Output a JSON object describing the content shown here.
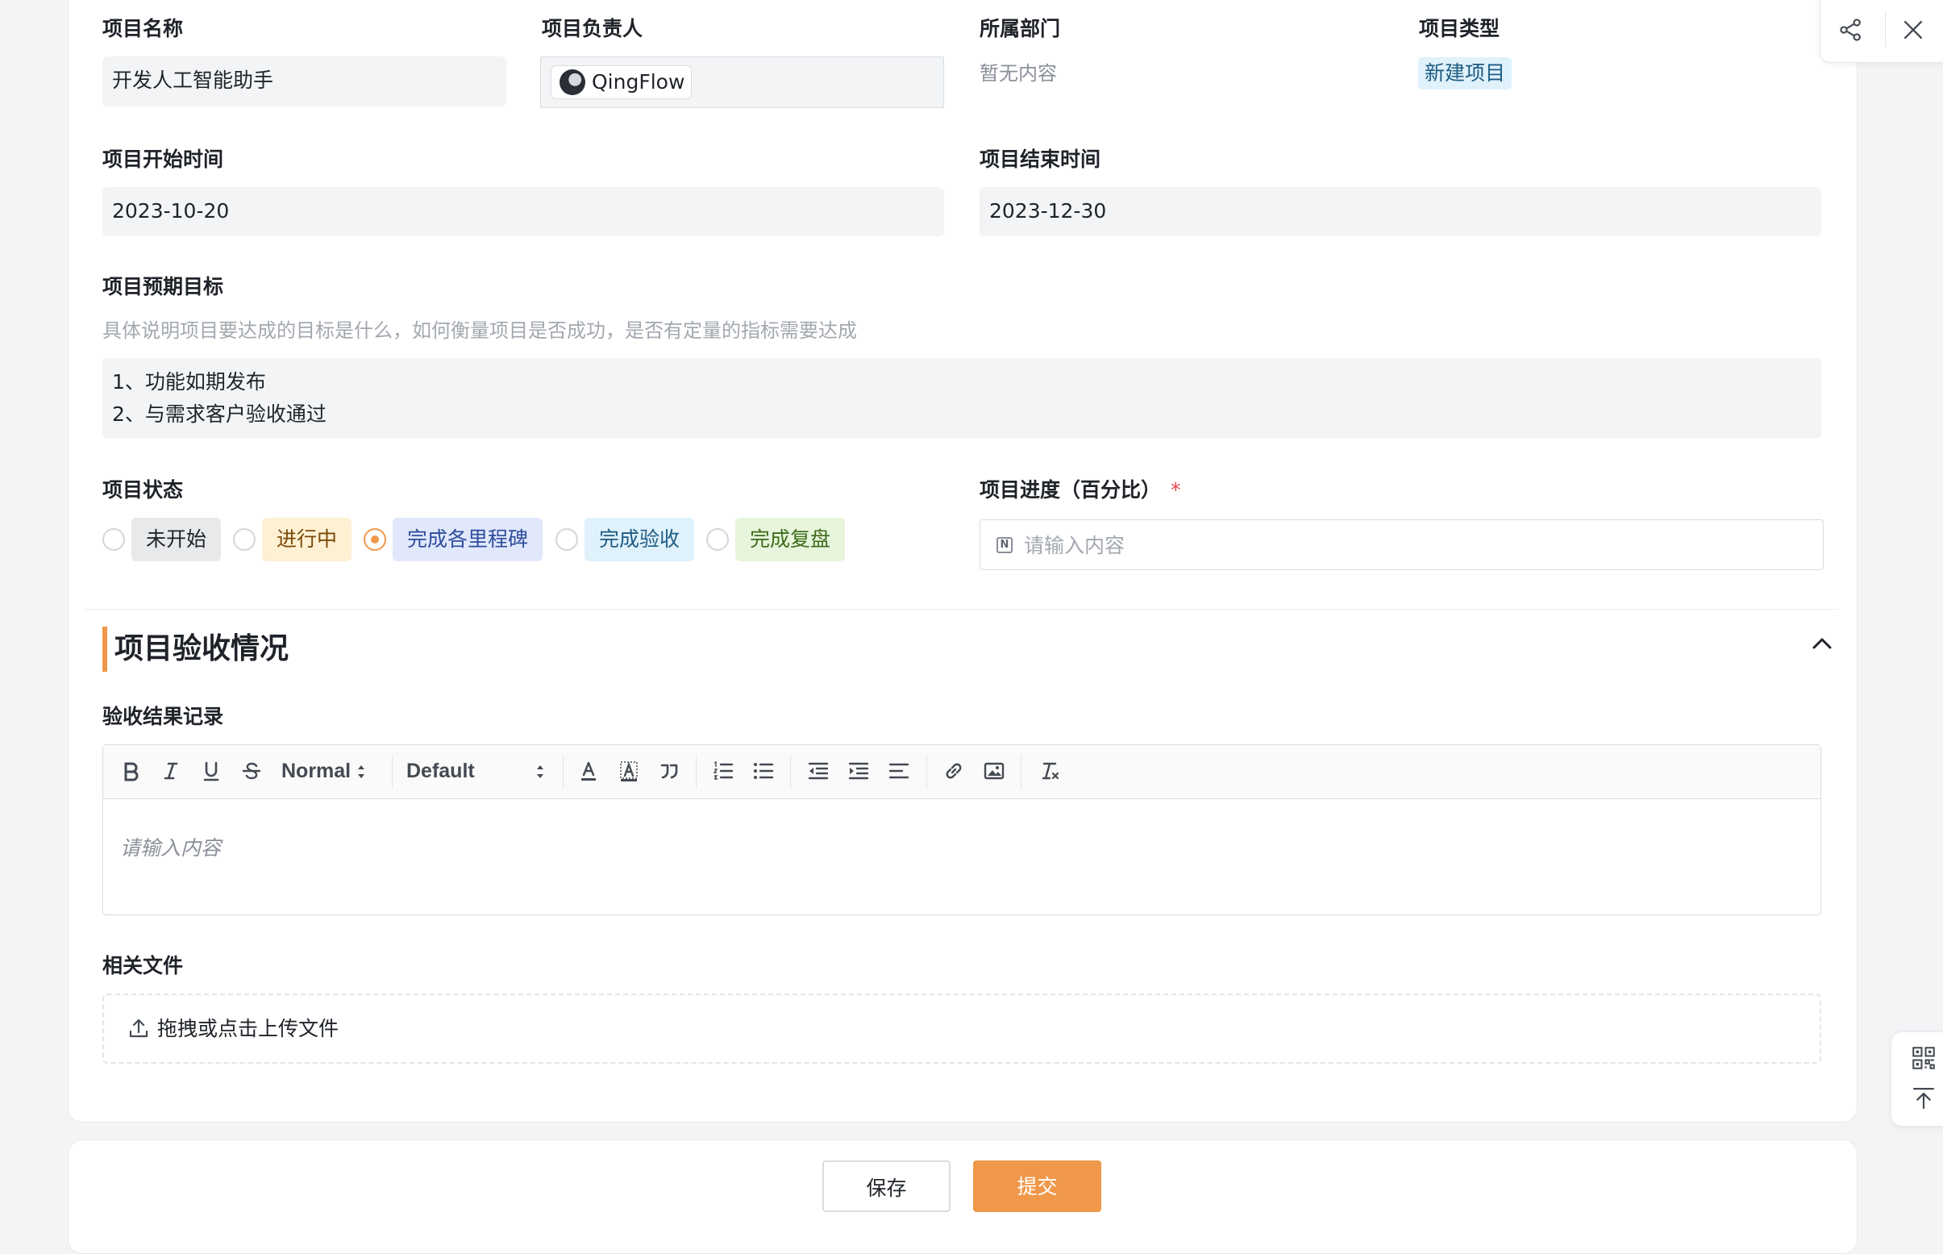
{
  "form": {
    "project_name": {
      "label": "项目名称",
      "value": "开发人工智能助手"
    },
    "owner": {
      "label": "项目负责人",
      "value": "QingFlow"
    },
    "department": {
      "label": "所属部门",
      "value": "暂无内容"
    },
    "project_type": {
      "label": "项目类型",
      "value": "新建项目"
    },
    "start_time": {
      "label": "项目开始时间",
      "value": "2023-10-20"
    },
    "end_time": {
      "label": "项目结束时间",
      "value": "2023-12-30"
    },
    "goal": {
      "label": "项目预期目标",
      "hint": "具体说明项目要达成的目标是什么，如何衡量项目是否成功，是否有定量的指标需要达成",
      "lines": [
        "1、功能如期发布",
        "2、与需求客户验收通过"
      ]
    },
    "status": {
      "label": "项目状态",
      "options": [
        {
          "label": "未开始",
          "bg": "#e8e9eb",
          "color": "#1f2329"
        },
        {
          "label": "进行中",
          "bg": "#fdf0d3",
          "color": "#7a4a08"
        },
        {
          "label": "完成各里程碑",
          "bg": "#e1e8fb",
          "color": "#2d4c9c"
        },
        {
          "label": "完成验收",
          "bg": "#dff1fb",
          "color": "#1d5b82"
        },
        {
          "label": "完成复盘",
          "bg": "#e6f5db",
          "color": "#3f6b1b"
        }
      ],
      "selected": "完成各里程碑"
    },
    "progress": {
      "label": "项目进度（百分比）",
      "required_mark": "*",
      "placeholder": "请输入内容"
    }
  },
  "acceptance": {
    "title": "项目验收情况",
    "record_label": "验收结果记录",
    "editor": {
      "header_select": "Normal",
      "font_select": "Default",
      "placeholder": "请输入内容",
      "tools": [
        "bold-icon",
        "italic-icon",
        "underline-icon",
        "strike-icon",
        "text-color-icon",
        "background-color-icon",
        "quote-icon",
        "ordered-list-icon",
        "bullet-list-icon",
        "outdent-icon",
        "indent-icon",
        "align-icon",
        "link-icon",
        "image-icon",
        "clear-format-icon"
      ]
    },
    "files_label": "相关文件",
    "upload_text": "拖拽或点击上传文件"
  },
  "footer": {
    "save_label": "保存",
    "submit_label": "提交"
  },
  "colors": {
    "accent": "#f0984a",
    "required": "#e5484d"
  }
}
